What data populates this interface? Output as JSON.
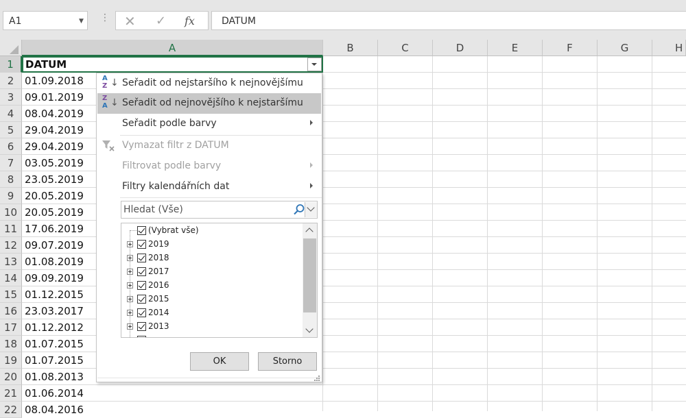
{
  "formula_bar": {
    "name_box": "A1",
    "formula": "DATUM"
  },
  "columns": [
    "A",
    "B",
    "C",
    "D",
    "E",
    "F",
    "G",
    "H"
  ],
  "rows": [
    {
      "num": "1",
      "value": "DATUM"
    },
    {
      "num": "2",
      "value": "01.09.2018"
    },
    {
      "num": "3",
      "value": "09.01.2019"
    },
    {
      "num": "4",
      "value": "08.04.2019"
    },
    {
      "num": "5",
      "value": "29.04.2019"
    },
    {
      "num": "6",
      "value": "29.04.2019"
    },
    {
      "num": "7",
      "value": "03.05.2019"
    },
    {
      "num": "8",
      "value": "23.05.2019"
    },
    {
      "num": "9",
      "value": "20.05.2019"
    },
    {
      "num": "10",
      "value": "20.05.2019"
    },
    {
      "num": "11",
      "value": "17.06.2019"
    },
    {
      "num": "12",
      "value": "09.07.2019"
    },
    {
      "num": "13",
      "value": "01.08.2019"
    },
    {
      "num": "14",
      "value": "09.09.2019"
    },
    {
      "num": "15",
      "value": "01.12.2015"
    },
    {
      "num": "16",
      "value": "23.03.2017"
    },
    {
      "num": "17",
      "value": "01.12.2012"
    },
    {
      "num": "18",
      "value": "01.07.2015"
    },
    {
      "num": "19",
      "value": "01.07.2015"
    },
    {
      "num": "20",
      "value": "01.08.2013"
    },
    {
      "num": "21",
      "value": "01.06.2014"
    },
    {
      "num": "22",
      "value": "08.04.2016"
    }
  ],
  "menu": {
    "sort_asc": "Seřadit od nejstaršího k nejnovějšímu",
    "sort_desc": "Seřadit od nejnovějšího k nejstaršímu",
    "sort_by_color": "Seřadit podle barvy",
    "clear_filter": "Vymazat filtr z DATUM",
    "filter_by_color": "Filtrovat podle barvy",
    "date_filters": "Filtry kalendářních dat",
    "search_placeholder": "Hledat (Vše)",
    "list": [
      {
        "label": "(Vybrat vše)",
        "checked": true,
        "expandable": false
      },
      {
        "label": "2019",
        "checked": true,
        "expandable": true
      },
      {
        "label": "2018",
        "checked": true,
        "expandable": true
      },
      {
        "label": "2017",
        "checked": true,
        "expandable": true
      },
      {
        "label": "2016",
        "checked": true,
        "expandable": true
      },
      {
        "label": "2015",
        "checked": true,
        "expandable": true
      },
      {
        "label": "2014",
        "checked": true,
        "expandable": true
      },
      {
        "label": "2013",
        "checked": true,
        "expandable": true
      }
    ],
    "ok": "OK",
    "cancel": "Storno"
  },
  "icons": {
    "cancel": "close-icon",
    "enter": "checkmark-icon",
    "function": "fx-icon",
    "search": "search-icon",
    "sort_asc": "sort-a-to-z-icon",
    "sort_desc": "sort-z-to-a-icon",
    "clear_filter": "clear-filter-icon"
  },
  "colors": {
    "accent": "#217346",
    "highlight": "#c8c8c8",
    "sort_icon_blue": "#2e75b6",
    "sort_icon_purple": "#7b4ba0"
  }
}
